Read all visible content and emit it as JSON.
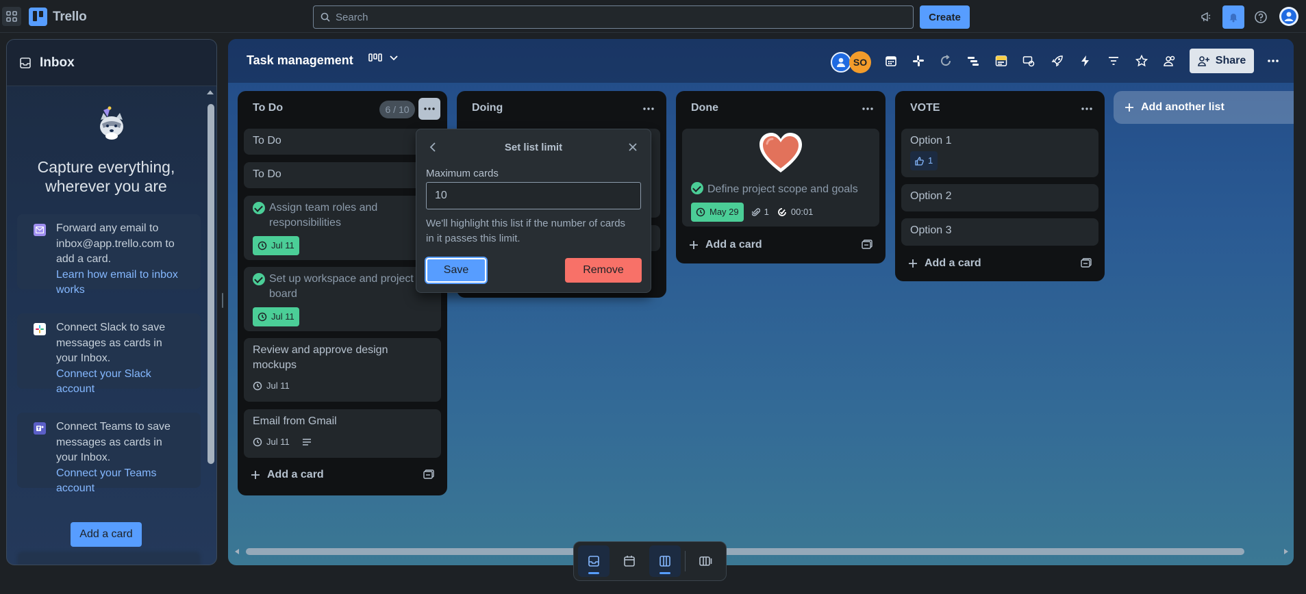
{
  "app": {
    "name": "Trello"
  },
  "topbar": {
    "search_placeholder": "Search",
    "create_label": "Create"
  },
  "inbox": {
    "title": "Inbox",
    "headline_line1": "Capture everything,",
    "headline_line2": "wherever you are",
    "email_card": {
      "text_line1": "Forward any email to",
      "text_line2": "inbox@app.trello.com to",
      "text_line3": "add a card.",
      "link_line1": "Learn how email to inbox",
      "link_line2": "works"
    },
    "slack_card": {
      "text_line1": "Connect Slack to save",
      "text_line2": "messages as cards in",
      "text_line3": "your Inbox.",
      "link_line1": "Connect your Slack",
      "link_line2": "account"
    },
    "teams_card": {
      "text_line1": "Connect Teams to save",
      "text_line2": "messages as cards in",
      "text_line3": "your Inbox.",
      "link_line1": "Connect your Teams",
      "link_line2": "account"
    },
    "add_card_label": "Add a card"
  },
  "board": {
    "title": "Task management",
    "member_initials": "SO",
    "share_label": "Share",
    "add_list_label": "Add another list",
    "lists": {
      "todo": {
        "title": "To Do",
        "count": "6 / 10",
        "cards": [
          {
            "title": "To Do"
          },
          {
            "title": "To Do"
          },
          {
            "title_line1": "Assign team roles and",
            "title_line2": "responsibilities",
            "date": "Jul 11"
          },
          {
            "title_line1": "Set up workspace and project",
            "title_line2": "board",
            "date": "Jul 11"
          },
          {
            "title_line1": "Review and approve design",
            "title_line2": "mockups",
            "date": "Jul 11"
          },
          {
            "title": "Email from Gmail",
            "date": "Jul 11"
          }
        ],
        "add_label": "Add a card"
      },
      "doing": {
        "title": "Doing"
      },
      "done": {
        "title": "Done",
        "card": {
          "title": "Define project scope and goals",
          "date": "May 29",
          "attachments": "1",
          "timer": "00:01"
        },
        "add_label": "Add a card"
      },
      "vote": {
        "title": "VOTE",
        "cards": [
          {
            "title": "Option 1",
            "votes": "1"
          },
          {
            "title": "Option 2"
          },
          {
            "title": "Option 3"
          }
        ],
        "add_label": "Add a card"
      }
    }
  },
  "popover": {
    "title": "Set list limit",
    "field_label": "Maximum cards",
    "field_value": "10",
    "help_line1": "We'll highlight this list if the number of cards",
    "help_line2": "in it passes this limit.",
    "save_label": "Save",
    "remove_label": "Remove"
  },
  "colors": {
    "accent": "#579dff",
    "success": "#4bce97",
    "danger": "#f87168",
    "member_avatar": "#f39c2b"
  },
  "icons": {
    "apps": "grid-icon",
    "search": "search-icon",
    "notifications": "megaphone-icon",
    "help": "help-icon",
    "close": "close-icon",
    "back": "chevron-left-icon"
  }
}
